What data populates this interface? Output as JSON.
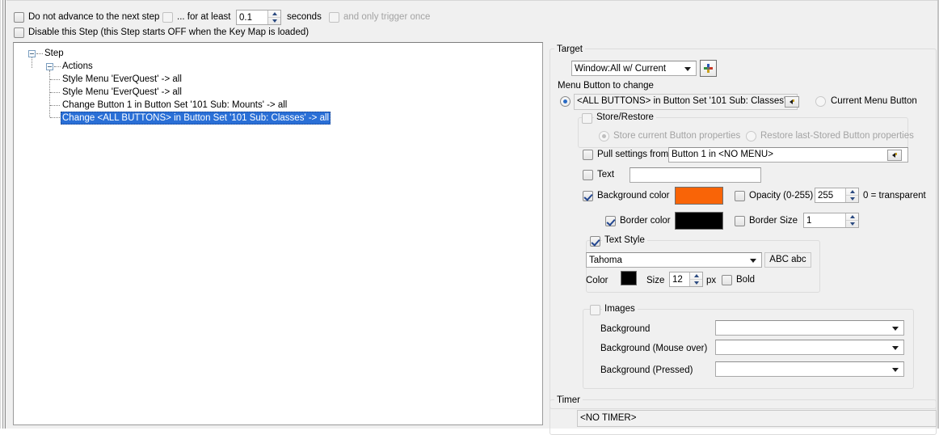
{
  "top_options": {
    "do_not_advance": {
      "label": "Do not advance to the next step",
      "checked": false
    },
    "for_at_least": {
      "label": "... for at least",
      "checked": false
    },
    "seconds_value": "0.1",
    "seconds_label": "seconds",
    "only_trigger_once": {
      "label": "and only trigger once",
      "checked": false,
      "enabled": false
    },
    "disable_step": {
      "label": "Disable this Step (this Step starts OFF when the Key Map is loaded)",
      "checked": false
    }
  },
  "tree": {
    "root": "Step",
    "child": "Actions",
    "items": [
      "Style Menu 'EverQuest' -> all",
      "Style Menu 'EverQuest' -> all",
      "Change Button 1 in Button Set '101 Sub: Mounts' -> all",
      "Change <ALL BUTTONS> in Button Set '101 Sub: Classes' -> all"
    ],
    "selected_index": 3
  },
  "target": {
    "group_label": "Target",
    "combo_value": "Window:All w/ Current",
    "star_button": "*"
  },
  "menu_button": {
    "section_label": "Menu Button to change",
    "all_buttons_radio_selected": true,
    "all_buttons_value": "<ALL BUTTONS> in Button Set '101 Sub: Classes'",
    "picker_button": "◄",
    "current_menu_button_label": "Current Menu Button",
    "current_menu_button_selected": false
  },
  "store_restore": {
    "title": "Store/Restore",
    "checked": false,
    "store_option": {
      "label": "Store current Button properties",
      "selected": true,
      "enabled": false
    },
    "restore_option": {
      "label": "Restore last-Stored Button properties",
      "selected": false,
      "enabled": false
    }
  },
  "pull_settings": {
    "label": "Pull settings from",
    "checked": false,
    "value": "Button 1 in <NO MENU>",
    "picker_button": "◄"
  },
  "text_field": {
    "label": "Text",
    "checked": false,
    "value": ""
  },
  "background_color": {
    "label": "Background color",
    "checked": true,
    "color": "#f96407"
  },
  "opacity": {
    "label": "Opacity (0-255)",
    "checked": false,
    "value": "255",
    "hint": "0 = transparent"
  },
  "border_color": {
    "label": "Border color",
    "checked": true,
    "color": "#000000"
  },
  "border_size": {
    "label": "Border Size",
    "checked": false,
    "value": "1"
  },
  "text_style": {
    "title": "Text Style",
    "checked": true,
    "font_value": "Tahoma",
    "preview": "ABC abc",
    "color_label": "Color",
    "color": "#000000",
    "size_label": "Size",
    "size_value": "12",
    "px_label": "px",
    "bold_label": "Bold",
    "bold_checked": false
  },
  "images": {
    "title": "Images",
    "checked": false,
    "rows": [
      {
        "label": "Background",
        "value": ""
      },
      {
        "label": "Background (Mouse over)",
        "value": ""
      },
      {
        "label": "Background (Pressed)",
        "value": ""
      }
    ]
  },
  "timer": {
    "group_label": "Timer",
    "value": "<NO TIMER>"
  }
}
